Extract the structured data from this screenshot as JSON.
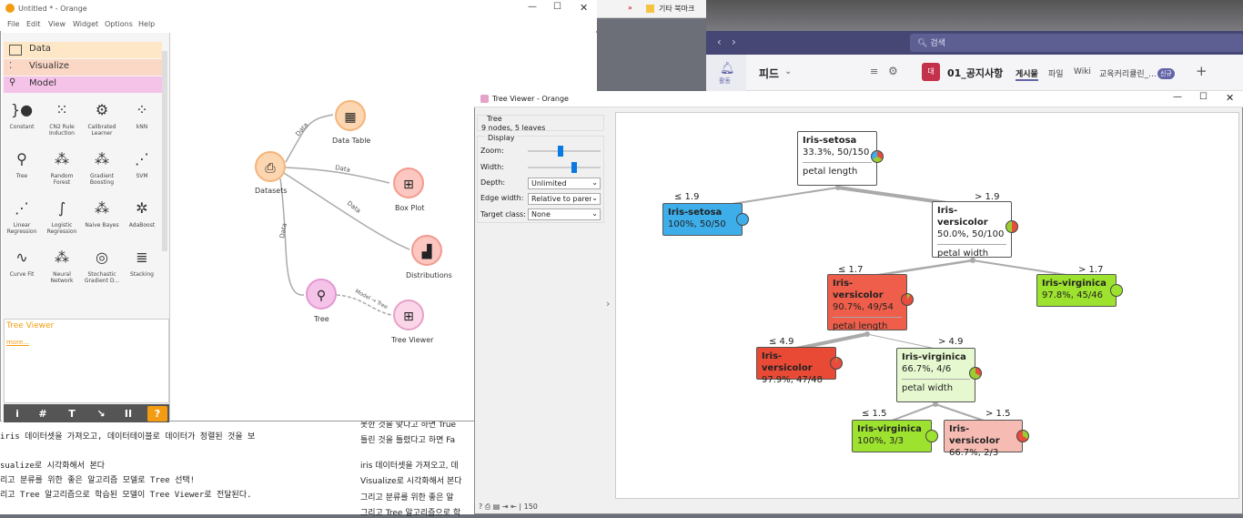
{
  "orange": {
    "title": "Untitled * - Orange",
    "menu": [
      "File",
      "Edit",
      "View",
      "Widget",
      "Options",
      "Help"
    ],
    "categories": [
      "Data",
      "Visualize",
      "Model"
    ],
    "widgets": [
      {
        "label": "Constant",
        "icon": "}●"
      },
      {
        "label": "CN2 Rule Induction",
        "icon": "⁙"
      },
      {
        "label": "Calibrated Learner",
        "icon": "⚙"
      },
      {
        "label": "kNN",
        "icon": "⁘"
      },
      {
        "label": "Tree",
        "icon": "⚲"
      },
      {
        "label": "Random Forest",
        "icon": "⁂"
      },
      {
        "label": "Gradient Boosting",
        "icon": "⁂"
      },
      {
        "label": "SVM",
        "icon": "⋰"
      },
      {
        "label": "Linear Regression",
        "icon": "⋰"
      },
      {
        "label": "Logistic Regression",
        "icon": "∫"
      },
      {
        "label": "Naive Bayes",
        "icon": "⁂"
      },
      {
        "label": "AdaBoost",
        "icon": "✲"
      },
      {
        "label": "Curve Fit",
        "icon": "∿"
      },
      {
        "label": "Neural Network",
        "icon": "⁂"
      },
      {
        "label": "Stochastic Gradient D...",
        "icon": "◎"
      },
      {
        "label": "Stacking",
        "icon": "≣"
      }
    ],
    "help_title": "Tree Viewer",
    "help_more": "more...",
    "bottom_buttons": [
      "i",
      "#",
      "T",
      "↘",
      "II",
      "?"
    ],
    "workflow": {
      "nodes": [
        "Datasets",
        "Data Table",
        "Box Plot",
        "Distributions",
        "Tree",
        "Tree Viewer"
      ],
      "links": [
        "Data",
        "Data",
        "Data",
        "Data",
        "Model → Tree"
      ]
    }
  },
  "tree_viewer": {
    "title": "Tree Viewer - Orange",
    "info_header": "Tree",
    "info_text": "9 nodes, 5 leaves",
    "display_header": "Display",
    "zoom_label": "Zoom:",
    "width_label": "Width:",
    "zoom_level": 0.45,
    "width_level": 0.65,
    "depth_label": "Depth:",
    "depth_value": "Unlimited",
    "edge_label": "Edge width:",
    "edge_value": "Relative to parent",
    "target_label": "Target class:",
    "target_value": "None",
    "status": "| 150",
    "nodes": {
      "root": {
        "name": "Iris-setosa",
        "stat": "33.3%, 50/150",
        "split": "petal length"
      },
      "n1": {
        "name": "Iris-setosa",
        "stat": "100%, 50/50"
      },
      "n2": {
        "name": "Iris-versicolor",
        "stat": "50.0%, 50/100",
        "split": "petal width"
      },
      "n3": {
        "name": "Iris-versicolor",
        "stat": "90.7%, 49/54",
        "split": "petal length"
      },
      "n4": {
        "name": "Iris-virginica",
        "stat": "97.8%, 45/46"
      },
      "n5": {
        "name": "Iris-versicolor",
        "stat": "97.9%, 47/48"
      },
      "n6": {
        "name": "Iris-virginica",
        "stat": "66.7%, 4/6",
        "split": "petal width"
      },
      "n7": {
        "name": "Iris-virginica",
        "stat": "100%, 3/3"
      },
      "n8": {
        "name": "Iris-versicolor",
        "stat": "66.7%, 2/3"
      }
    },
    "edges": {
      "e1": "≤ 1.9",
      "e2": "> 1.9",
      "e3": "≤ 1.7",
      "e4": "> 1.7",
      "e5": "≤ 4.9",
      "e6": "> 4.9",
      "e7": "≤ 1.5",
      "e8": "> 1.5"
    }
  },
  "teams": {
    "search": "검색",
    "feed": "피드",
    "team_badge": "대",
    "channel": "01_공지사항",
    "tabs": [
      "게시물",
      "파일",
      "Wiki",
      "교육커리큘린_..."
    ],
    "new_badge": "신규",
    "activity": "활동"
  },
  "browser": {
    "bookmark": "기타 북마크"
  },
  "doc_left": [
    "iris 데이터셋을 가져오고, 데이터테이블로 데이터가 정렬된 것을 보",
    "sualize로 시각화해서 본다",
    "리고 분류를 위한 좋은 알고리즘 모델로 Tree 선택!",
    "리고 Tree 알고리즘으로 학습된 모델이 Tree Viewer로 전달된다."
  ],
  "doc_right": [
    "못한 것을 맞다고 하면 True",
    "틀린 것을 틀렸다고 하면 Fa",
    "iris 데이터셋을 가져오고, 데",
    "Visualize로 시각화해서 본다",
    "그리고 분류를 위한 좋은 알",
    "그리고 Tree 알고리즘으로 학"
  ]
}
